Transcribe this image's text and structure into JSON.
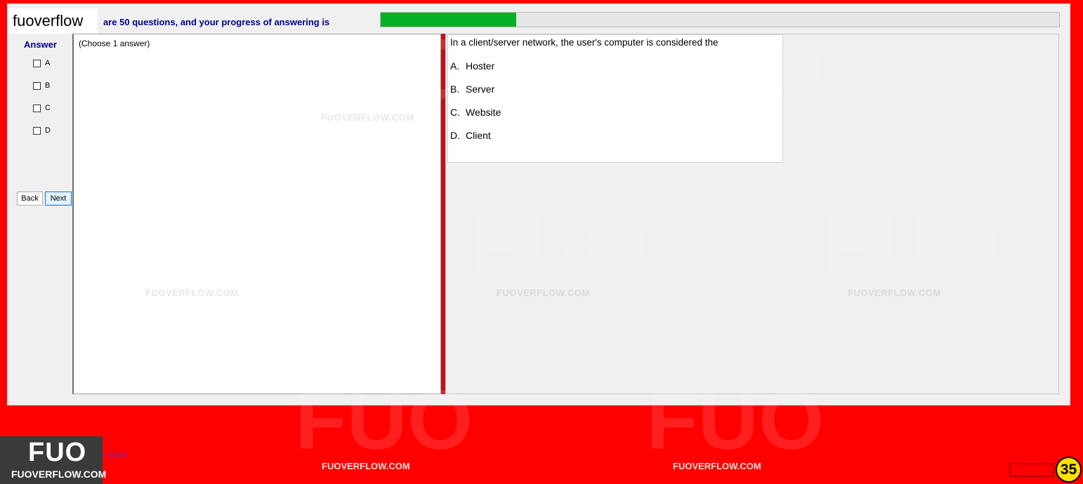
{
  "brand": {
    "name": "fuoverflow"
  },
  "progress": {
    "text": "are 50 questions, and your progress of answering is",
    "value": 0.2,
    "fill_color": "#06b025"
  },
  "answer": {
    "title": "Answer",
    "options": [
      "A",
      "B",
      "C",
      "D"
    ],
    "back_label": "Back",
    "next_label": "Next"
  },
  "left_panel": {
    "instruction": "(Choose 1 answer)"
  },
  "question": {
    "text": "In a client/server network, the user's computer is considered the",
    "options": [
      {
        "letter": "A.",
        "text": "Hoster"
      },
      {
        "letter": "B.",
        "text": "Server"
      },
      {
        "letter": "C.",
        "text": "Website"
      },
      {
        "letter": "D.",
        "text": "Client"
      }
    ]
  },
  "watermark": {
    "text": "FUOVERFLOW.COM",
    "logo_text": "FUO"
  },
  "footer": {
    "logo_big": "FUO",
    "logo_small": "FUOVERFLOW.COM",
    "exit_text": "exit the exam",
    "counter": "35"
  },
  "colors": {
    "background": "#ff0000",
    "accent": "#00008b",
    "divider": "#c1121a"
  }
}
